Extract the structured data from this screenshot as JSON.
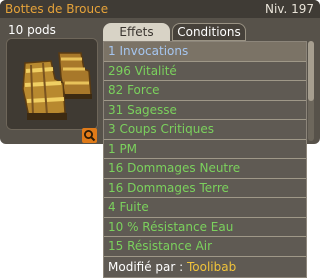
{
  "header": {
    "title": "Bottes de Brouce",
    "level": "Niv. 197"
  },
  "item": {
    "pods": "10 pods",
    "icon": "boots-icon"
  },
  "tabs": [
    {
      "label": "Effets",
      "active": true
    },
    {
      "label": "Conditions",
      "active": false
    }
  ],
  "effects": [
    {
      "text": "1 Invocations"
    },
    {
      "text": "296 Vitalité"
    },
    {
      "text": "82 Force"
    },
    {
      "text": "31 Sagesse"
    },
    {
      "text": "3 Coups Critiques"
    },
    {
      "text": "1 PM"
    },
    {
      "text": "16 Dommages Neutre"
    },
    {
      "text": "16 Dommages Terre"
    },
    {
      "text": "4 Fuite"
    },
    {
      "text": "10 % Résistance Eau"
    },
    {
      "text": "15 Résistance Air"
    }
  ],
  "footer": {
    "label": "Modifié par :",
    "author": "Toolibab"
  },
  "colors": {
    "title": "#e6a33a",
    "effect_green": "#7bd15d",
    "effect_blue": "#a6c6f0",
    "author": "#f0c33a",
    "search": "#df7a19"
  }
}
